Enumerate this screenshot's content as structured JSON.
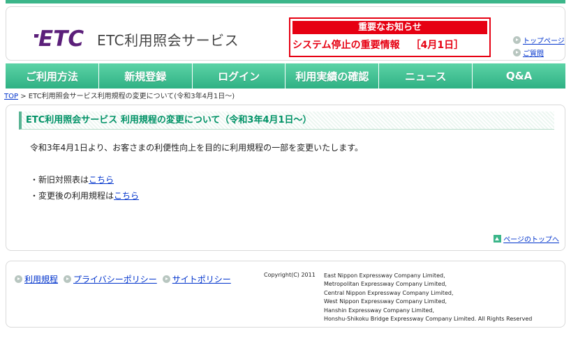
{
  "header": {
    "logo_text": "ETC",
    "service_name": "ETC利用照会サービス",
    "notice": {
      "title": "重要なお知らせ",
      "link_text": "システム停止の重要情報",
      "date": "［4月1日］"
    },
    "quick_links": [
      "トップページ",
      "ご質問"
    ]
  },
  "nav": [
    "ご利用方法",
    "新規登録",
    "ログイン",
    "利用実績の確認",
    "ニュース",
    "Q&A"
  ],
  "breadcrumb": {
    "top": "TOP",
    "separator": ">",
    "current": "ETC利用照会サービス利用規程の変更について(令和3年4月1日～)"
  },
  "main": {
    "title": "ETC利用照会サービス 利用規程の変更について（令和3年4月1日～）",
    "intro": "令和3年4月1日より、お客さまの利便性向上を目的に利用規程の一部を変更いたします。",
    "items": [
      {
        "prefix": "・新旧対照表は",
        "link": "こちら"
      },
      {
        "prefix": "・変更後の利用規程は",
        "link": "こちら"
      }
    ],
    "page_top": "ページのトップへ"
  },
  "footer": {
    "links": [
      "利用規程",
      "プライバシーポリシー",
      "サイトポリシー"
    ],
    "copyright": "Copyright(C) 2011",
    "companies": [
      "East Nippon Expressway Company Limited,",
      "Metropolitan Expressway Company Limited,",
      "Central Nippon Expressway Company Limited,",
      "West Nippon Expressway Company Limited,",
      "Hanshin Expressway Company Limited,",
      "Honshu-Shikoku Bridge Expressway Company Limited. All Rights Reserved"
    ]
  },
  "colors": {
    "accent_green": "#3cb68a",
    "notice_red": "#e60012",
    "logo_purple": "#5b1f7a",
    "link_blue": "#0033cc"
  }
}
